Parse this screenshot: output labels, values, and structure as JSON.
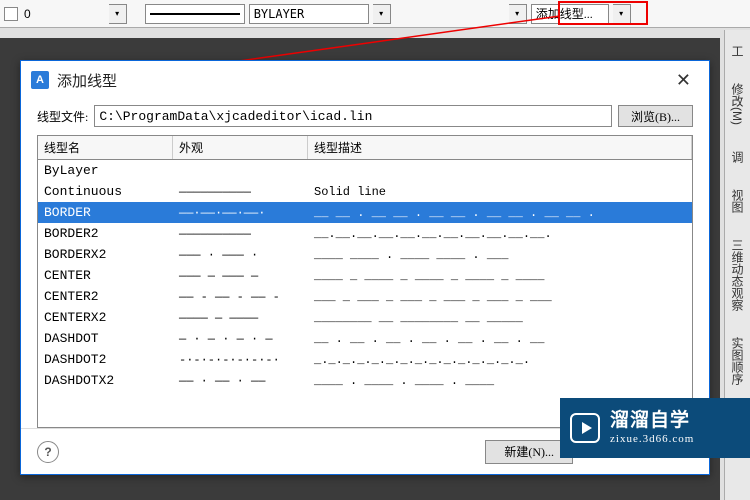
{
  "toolbar": {
    "layer_zero": "0",
    "linetype_combo": "BYLAYER",
    "add_linetype_btn": "添加线型..."
  },
  "side_tabs": [
    "工",
    "修改(M)",
    "调",
    "视图",
    "三维动态观察",
    "实图顺序"
  ],
  "dialog": {
    "title": "添加线型",
    "file_label": "线型文件:",
    "file_path": "C:\\ProgramData\\xjcadeditor\\icad.lin",
    "browse_label": "浏览(B)...",
    "columns": {
      "name": "线型名",
      "appearance": "外观",
      "desc": "线型描述"
    },
    "rows": [
      {
        "name": "ByLayer",
        "app": "",
        "desc": ""
      },
      {
        "name": "Continuous",
        "app": "——————————",
        "desc": "Solid line"
      },
      {
        "name": "BORDER",
        "app": "——·——·——·——·",
        "desc": "__ __ . __ __ . __ __ . __ __ . __ __ ."
      },
      {
        "name": "BORDER2",
        "app": "——————————",
        "desc": "__.__.__.__.__.__.__.__.__.__.__."
      },
      {
        "name": "BORDERX2",
        "app": "——— · ——— ·",
        "desc": "____  ____  .  ____  ____  .  ___"
      },
      {
        "name": "CENTER",
        "app": "——— — ——— —",
        "desc": "____ _ ____ _ ____ _ ____ _ ____"
      },
      {
        "name": "CENTER2",
        "app": "—— - —— - —— -",
        "desc": "___ _ ___ _ ___ _ ___ _ ___ _ ___"
      },
      {
        "name": "CENTERX2",
        "app": "———— — ————",
        "desc": "________  __  ________  __  _____"
      },
      {
        "name": "DASHDOT",
        "app": "— · — · — · —",
        "desc": "__ . __ . __ . __ . __ . __ . __"
      },
      {
        "name": "DASHDOT2",
        "app": "-·-·-·-·-·-·-·",
        "desc": "_._._._._._._._._._._._._._._."
      },
      {
        "name": "DASHDOTX2",
        "app": "—— · —— · ——",
        "desc": "____  .  ____  .  ____  .  ____"
      }
    ],
    "selected_index": 2,
    "new_btn": "新建(N)...",
    "help_icon_name": "help"
  },
  "watermark": {
    "main": "溜溜自学",
    "sub": "zixue.3d66.com"
  }
}
